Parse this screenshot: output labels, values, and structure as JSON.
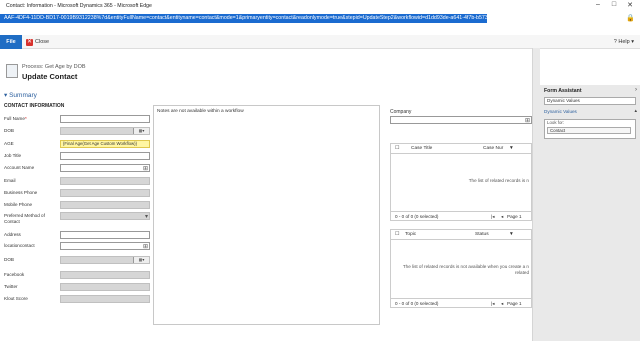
{
  "window": {
    "title": "Contact: Information - Microsoft Dynamics 365 - Microsoft Edge"
  },
  "address": {
    "url": "AAF-4DF4-11DD-BD17-0019B9312238%7d&entityFullName=contact&entityname=contact&mode=1&primaryentity=contact&readonlymode=true&stepid=UpdateStep2&workflowid=d1dd93de-a641-4f7b-b573-4624b2bd1389"
  },
  "ribbon": {
    "file_label": "File",
    "close_label": "Close",
    "help_label": "Help"
  },
  "header": {
    "process": "Process: Get Age by DOB",
    "title": "Update Contact"
  },
  "summary_label": "Summary",
  "form": {
    "section": "CONTACT INFORMATION",
    "fields": [
      {
        "label": "Full Name",
        "required": "*",
        "value": ""
      },
      {
        "label": "DOB",
        "value": ""
      },
      {
        "label": "AGE",
        "value": "{Final Age(Get Age Custom Workflow)}"
      },
      {
        "label": "Job Title",
        "value": ""
      },
      {
        "label": "Account Name",
        "value": ""
      },
      {
        "label": "Email",
        "value": ""
      },
      {
        "label": "Business Phone",
        "value": ""
      },
      {
        "label": "Mobile Phone",
        "value": ""
      },
      {
        "label": "Preferred Method of Contact",
        "value": ""
      },
      {
        "label": "Address",
        "value": ""
      },
      {
        "label": "locationcontact",
        "value": ""
      },
      {
        "label": "DOB",
        "value": ""
      },
      {
        "label": "Facebook",
        "value": ""
      },
      {
        "label": "Twitter",
        "value": ""
      },
      {
        "label": "Klout Score",
        "value": ""
      }
    ]
  },
  "notes": {
    "text": "Notes are not available within a workflow"
  },
  "company": {
    "label": "Company"
  },
  "case_grid": {
    "col1": "Case Title",
    "col2": "Case Nur",
    "empty": "The list of related records is n",
    "count": "0 - 0 of 0 (0 selected)",
    "page": "Page 1"
  },
  "topic_grid": {
    "col1": "Topic",
    "col2": "Status",
    "empty1": "The list of related records is not available when you create a n",
    "empty2": "related",
    "count": "0 - 0 of 0 (0 selected)",
    "page": "Page 1"
  },
  "assistant": {
    "title": "Form Assistant",
    "dropdown": "Dynamic Values",
    "section": "Dynamic Values",
    "look_for_label": "Look for:",
    "look_for_value": "Contact"
  }
}
